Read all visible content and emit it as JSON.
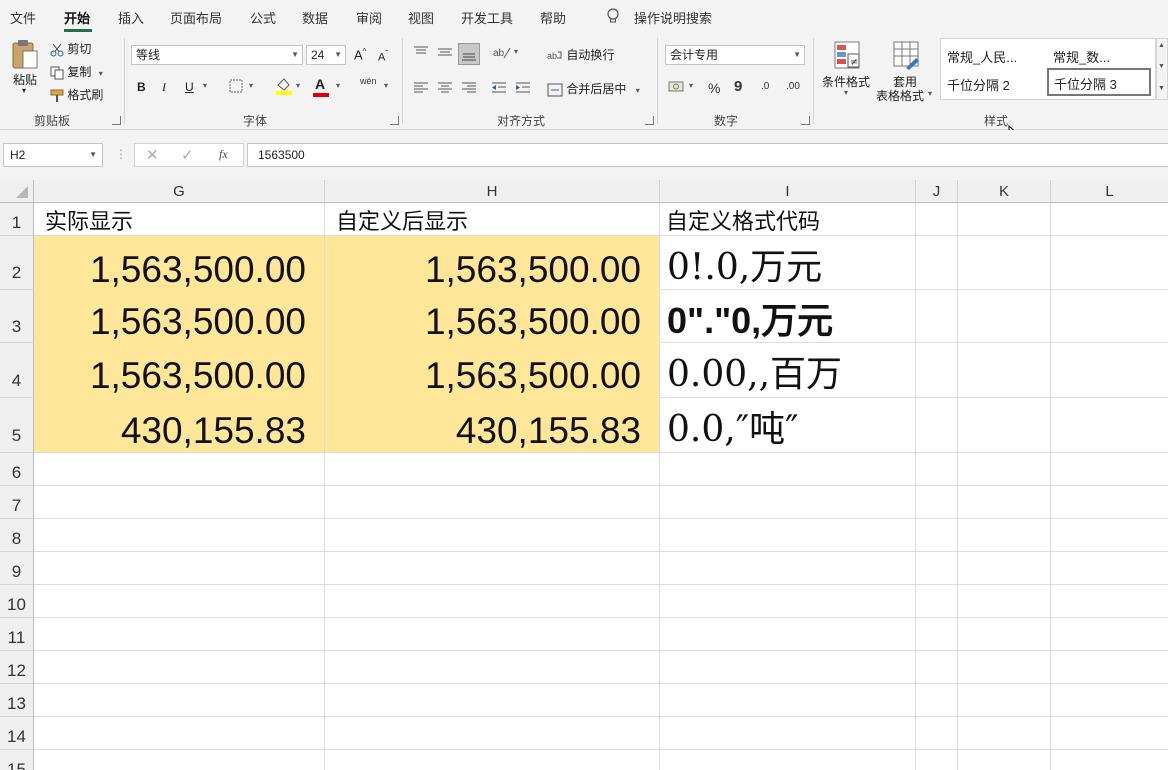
{
  "menu": [
    "文件",
    "开始",
    "插入",
    "页面布局",
    "公式",
    "数据",
    "审阅",
    "视图",
    "开发工具",
    "帮助"
  ],
  "search_hint": "操作说明搜索",
  "clipboard": {
    "paste": "粘贴",
    "cut": "剪切",
    "copy": "复制",
    "format_painter": "格式刷",
    "label": "剪贴板"
  },
  "font": {
    "name": "等线",
    "size": "24",
    "grow": "A",
    "shrink": "A",
    "bold": "B",
    "italic": "I",
    "underline": "U",
    "font_color_glyph": "A",
    "phonetic": "wén",
    "label": "字体"
  },
  "alignment": {
    "wrap": "自动换行",
    "merge": "合并后居中",
    "label": "对齐方式"
  },
  "number": {
    "format": "会计专用",
    "percent": "%",
    "comma": "9",
    "inc": ".0",
    "dec": ".00",
    "label": "数字"
  },
  "styles": {
    "cond": "条件格式",
    "table1": "套用",
    "table2": "表格格式",
    "cells": [
      "常规_人民...",
      "常规_数...",
      "千位分隔 2",
      "千位分隔 3"
    ],
    "label": "样式"
  },
  "formula_bar": {
    "name_box": "H2",
    "fx": "fx",
    "value": "1563500"
  },
  "colors": {
    "accent": "#217346",
    "fill": "#ffe699"
  },
  "columns": [
    "G",
    "H",
    "I",
    "J",
    "K",
    "L"
  ],
  "rows": [
    "1",
    "2",
    "3",
    "4",
    "5",
    "6",
    "7",
    "8",
    "9",
    "10",
    "11",
    "12",
    "13",
    "14",
    "15"
  ],
  "cells": {
    "G1": "实际显示",
    "H1": "自定义后显示",
    "I1": "自定义格式代码",
    "G2": "1,563,500.00",
    "H2": "1,563,500.00",
    "I2": "0!.0,万元",
    "G3": "1,563,500.00",
    "H3": "1,563,500.00",
    "I3": "0\".\"0,万元",
    "G4": "1,563,500.00",
    "H4": "1,563,500.00",
    "I4": "0.00,,百万",
    "G5": "430,155.83",
    "H5": "430,155.83",
    "I5": "0.0,″吨″"
  }
}
